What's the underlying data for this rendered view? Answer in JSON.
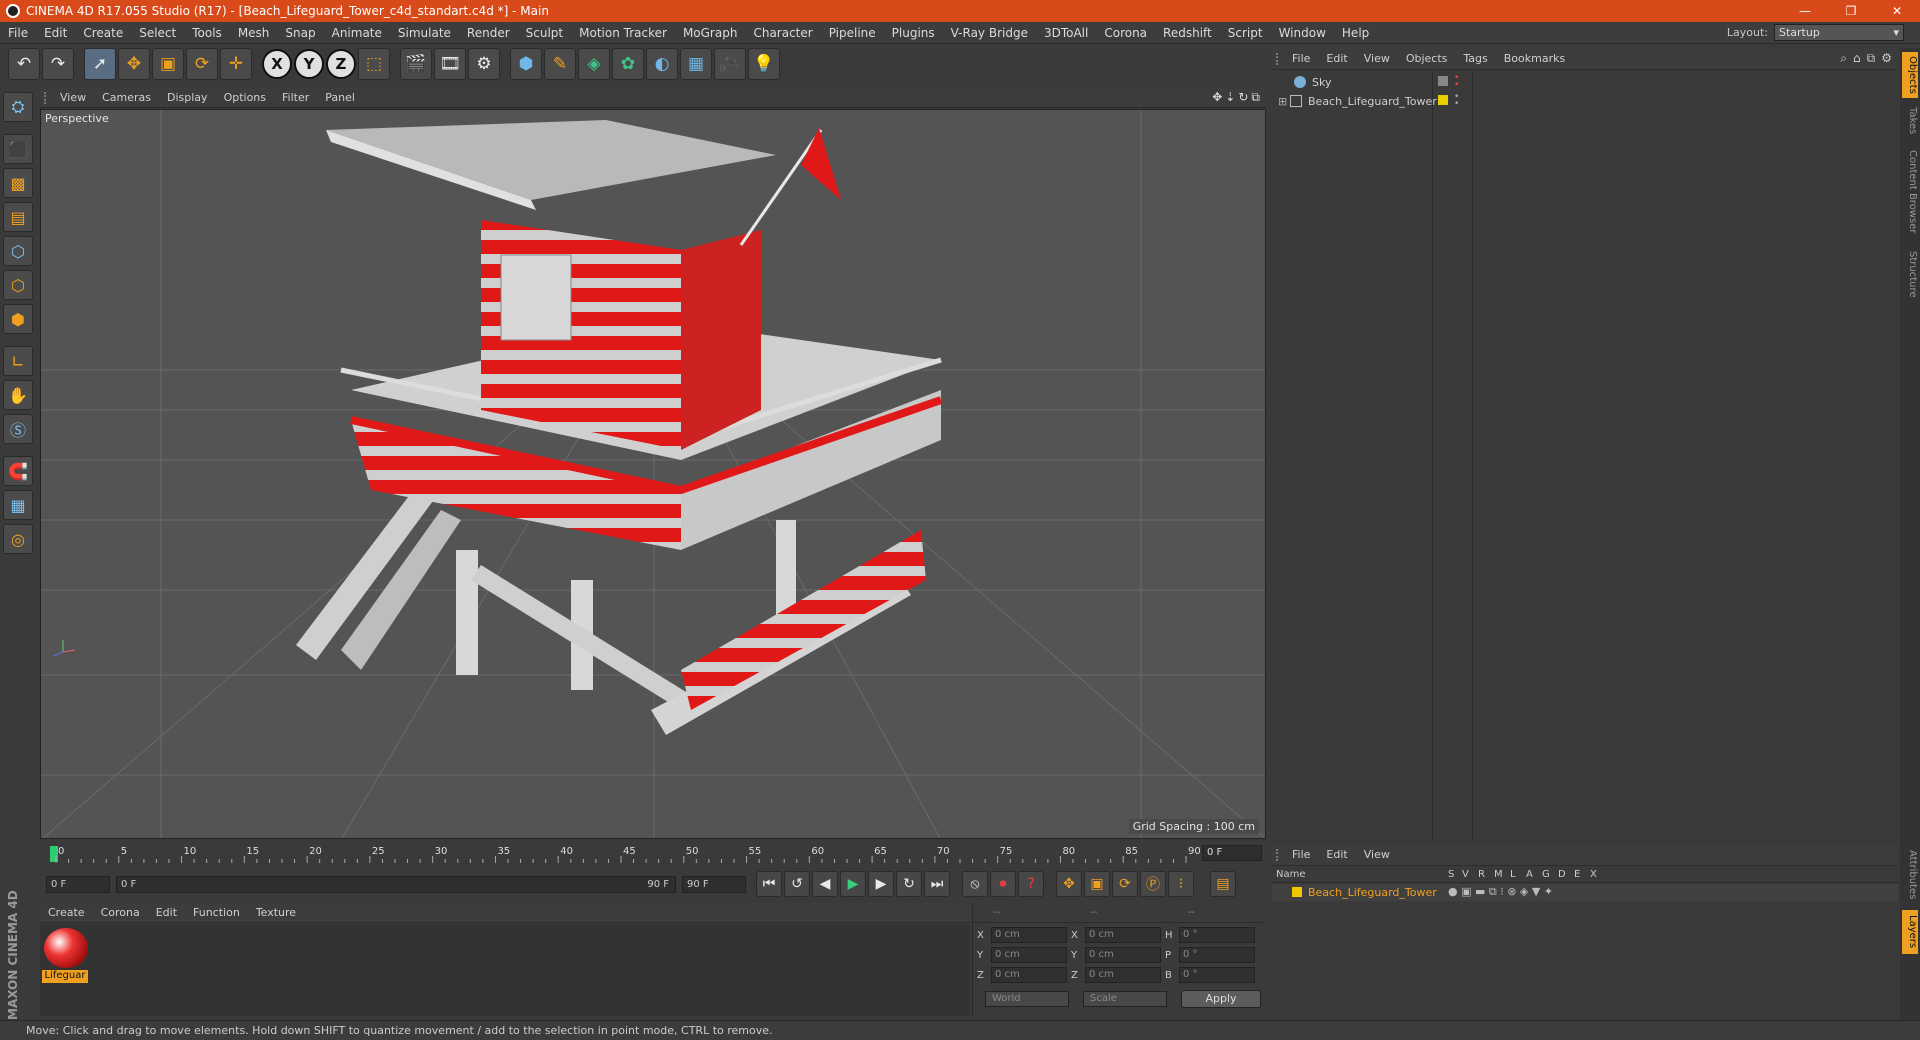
{
  "app": {
    "title": "CINEMA 4D R17.055 Studio (R17) - [Beach_Lifeguard_Tower_c4d_standart.c4d *] - Main"
  },
  "menu": [
    "File",
    "Edit",
    "Create",
    "Select",
    "Tools",
    "Mesh",
    "Snap",
    "Animate",
    "Simulate",
    "Render",
    "Sculpt",
    "Motion Tracker",
    "MoGraph",
    "Character",
    "Pipeline",
    "Plugins",
    "V-Ray Bridge",
    "3DToAll",
    "Corona",
    "Redshift",
    "Script",
    "Window",
    "Help"
  ],
  "layout": {
    "label": "Layout:",
    "value": "Startup"
  },
  "viewport": {
    "menu": [
      "View",
      "Cameras",
      "Display",
      "Options",
      "Filter",
      "Panel"
    ],
    "label": "Perspective",
    "grid_spacing": "Grid Spacing : 100 cm"
  },
  "timeline": {
    "ticks": [
      "0",
      "5",
      "10",
      "15",
      "20",
      "25",
      "30",
      "35",
      "40",
      "45",
      "50",
      "55",
      "60",
      "65",
      "70",
      "75",
      "80",
      "85",
      "90"
    ],
    "current_frame": "0 F"
  },
  "transport": {
    "start": "0 F",
    "range_start": "0 F",
    "range_end": "90 F",
    "end": "90 F"
  },
  "material_manager": {
    "menu": [
      "Create",
      "Corona",
      "Edit",
      "Function",
      "Texture"
    ],
    "materials": [
      {
        "name": "Lifeguar"
      }
    ]
  },
  "coordinates": {
    "headers": [
      "--",
      "--",
      "--"
    ],
    "rows": [
      {
        "a": "X",
        "av": "0 cm",
        "b": "X",
        "bv": "0 cm",
        "c": "H",
        "cv": "0 °"
      },
      {
        "a": "Y",
        "av": "0 cm",
        "b": "Y",
        "bv": "0 cm",
        "c": "P",
        "cv": "0 °"
      },
      {
        "a": "Z",
        "av": "0 cm",
        "b": "Z",
        "bv": "0 cm",
        "c": "B",
        "cv": "0 °"
      }
    ],
    "mode": "World",
    "size_mode": "Scale",
    "apply": "Apply"
  },
  "object_manager": {
    "menu": [
      "File",
      "Edit",
      "View",
      "Objects",
      "Tags",
      "Bookmarks"
    ],
    "objects": [
      {
        "name": "Sky"
      },
      {
        "name": "Beach_Lifeguard_Tower"
      }
    ]
  },
  "layer_manager": {
    "menu": [
      "File",
      "Edit",
      "View"
    ],
    "columns": [
      "Name",
      "S",
      "V",
      "R",
      "M",
      "L",
      "A",
      "G",
      "D",
      "E",
      "X"
    ],
    "layers": [
      {
        "name": "Beach_Lifeguard_Tower",
        "color": "#f0c800"
      }
    ]
  },
  "right_tabs": [
    "Objects",
    "Takes",
    "Content Browser",
    "Structure",
    "Attributes",
    "Layers"
  ],
  "status": "Move: Click and drag to move elements. Hold down SHIFT to quantize movement / add to the selection in point mode, CTRL to remove.",
  "colors": {
    "accent": "#f0a020",
    "titlebar": "#d84a1a",
    "tower_red": "#e01818"
  },
  "brand": "MAXON CINEMA 4D"
}
